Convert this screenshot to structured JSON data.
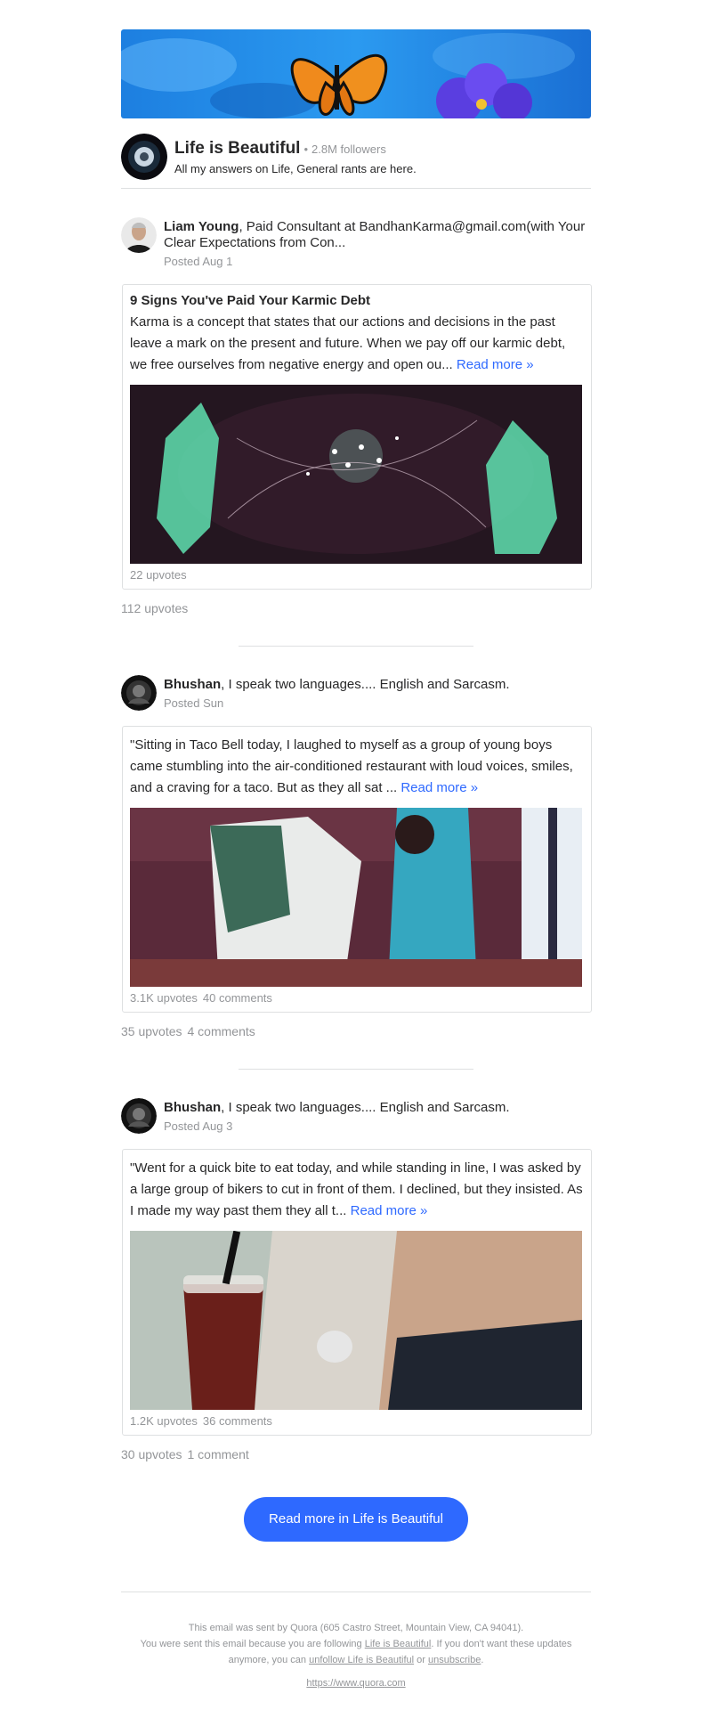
{
  "space": {
    "title": "Life is Beautiful",
    "dot": "•",
    "followers": "2.8M followers",
    "description": "All my answers on Life, General rants are here."
  },
  "posts": [
    {
      "author_name": "Liam Young",
      "author_cred": ", Paid Consultant at BandhanKarma@gmail.com(with Your Clear Expectations from Con...",
      "posted": "Posted Aug 1",
      "card_title": "9 Signs You've Paid Your Karmic Debt",
      "card_body": "Karma is a concept that states that our actions and decisions in the past leave a mark on the present and future. When we pay off our karmic debt, we free ourselves from negative energy and open ou...",
      "read_more": "Read more »",
      "card_upvotes": "22 upvotes",
      "card_comments": "",
      "upvotes": "112 upvotes",
      "comments": ""
    },
    {
      "author_name": "Bhushan",
      "author_cred": ", I speak two languages.... English and Sarcasm.",
      "posted": "Posted Sun",
      "card_body": "\"Sitting in Taco Bell today, I laughed to myself as a group of young boys came stumbling into the air-conditioned restaurant with loud voices, smiles, and a craving for a taco. But as they all sat ...",
      "read_more": "Read more »",
      "card_upvotes": "3.1K upvotes",
      "card_comments": "40 comments",
      "upvotes": "35 upvotes",
      "comments": "4 comments"
    },
    {
      "author_name": "Bhushan",
      "author_cred": ", I speak two languages.... English and Sarcasm.",
      "posted": "Posted Aug 3",
      "card_body": "\"Went for a quick bite to eat today, and while standing in line, I was asked by a large group of bikers to cut in front of them. I declined, but they insisted. As I made my way past them they all t...",
      "read_more": "Read more »",
      "card_upvotes": "1.2K upvotes",
      "card_comments": "36 comments",
      "upvotes": "30 upvotes",
      "comments": "1 comment"
    }
  ],
  "cta_label": "Read more in Life is Beautiful",
  "footer": {
    "line1": "This email was sent by Quora (605 Castro Street, Mountain View, CA 94041).",
    "line2a": "You were sent this email because you are following ",
    "line2_link": "Life is Beautiful",
    "line2b": ". If you don't want these updates anymore, you can ",
    "unfollow_link": "unfollow Life is Beautiful",
    "or": " or ",
    "unsubscribe_link": "unsubscribe",
    "period": ".",
    "url": "https://www.quora.com"
  },
  "colors": {
    "accent": "#2e69ff",
    "muted": "#939598",
    "text": "#282829",
    "border": "#dee0e1"
  }
}
